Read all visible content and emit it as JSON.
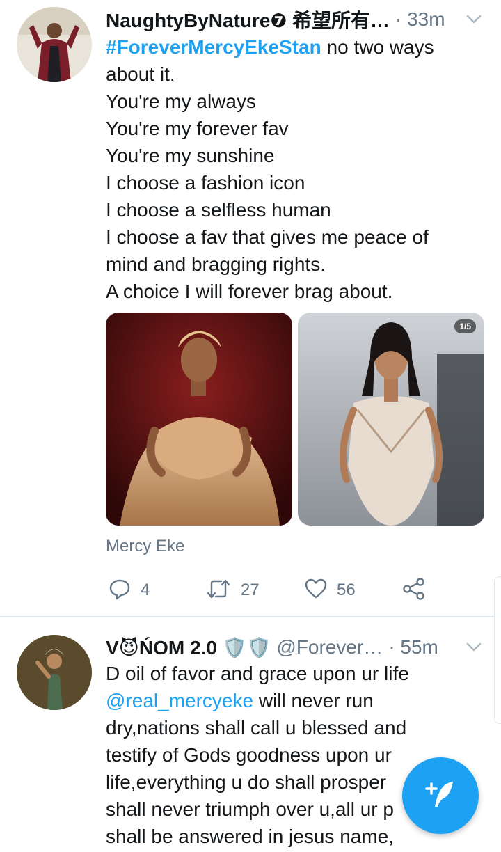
{
  "tweets": [
    {
      "display_name": "NaughtyByNature❼ 希望所有…",
      "handle": "",
      "time": "· 33m",
      "hashtag": "#ForeverMercyEkeStan",
      "first_line_rest": " no two ways",
      "lines": [
        "about it.",
        "You're my always",
        "You're my forever fav",
        "You're my sunshine",
        "I choose a fashion icon",
        "I choose a selfless human",
        "I choose a fav that gives me peace of",
        "mind and bragging rights.",
        "A choice I will forever brag about."
      ],
      "media_counter": "1/5",
      "tagged": "Mercy Eke",
      "replies": "4",
      "retweets": "27",
      "likes": "56"
    },
    {
      "display_name": "V😈ŃOM 2.0 🛡️🛡️",
      "handle": "@Forever…",
      "time": "· 55m",
      "line1": "D oil of favor and grace upon ur life",
      "mention": "@real_mercyeke",
      "mention_rest": " will never run",
      "lines": [
        "dry,nations shall call u blessed and",
        "testify of Gods goodness upon ur",
        "life,everything u do shall prosper",
        "shall never triumph over u,all ur p",
        "shall be answered in jesus name,"
      ]
    }
  ],
  "colors": {
    "accent": "#1da1f2",
    "secondary_text": "#657786",
    "divider": "#e1e8ed"
  },
  "icons": {
    "reply": "reply-icon",
    "retweet": "retweet-icon",
    "like": "heart-icon",
    "share": "share-icon",
    "compose": "compose-icon",
    "more": "chevron-down-icon"
  }
}
